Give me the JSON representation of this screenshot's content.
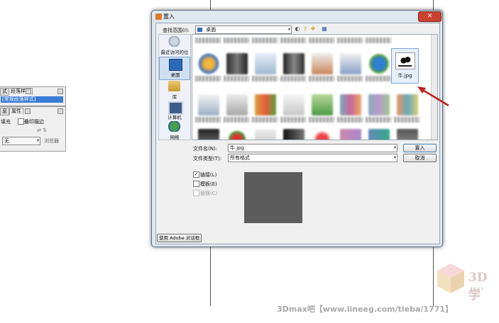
{
  "dialog": {
    "title": "置入",
    "close_glyph": "✕",
    "look_in_label": "查找范围(I):",
    "look_in_value": "桌面",
    "places": [
      {
        "label": "最近访问的位置",
        "icon": "recent-places-icon"
      },
      {
        "label": "桌面",
        "icon": "desktop-icon",
        "selected": true
      },
      {
        "label": "库",
        "icon": "library-icon"
      },
      {
        "label": "计算机",
        "icon": "computer-icon"
      },
      {
        "label": "网络",
        "icon": "network-icon"
      }
    ],
    "toolbar_icons": [
      "back-icon",
      "up-folder-icon",
      "new-folder-icon",
      "view-menu-icon"
    ],
    "selected_file": {
      "name": "牛.jpg"
    },
    "filename_label": "文件名(N):",
    "filename_value": "牛.jpg",
    "filetype_label": "文件类型(T):",
    "filetype_value": "所有格式",
    "open_button": "置入",
    "cancel_button": "取消",
    "options": [
      {
        "label": "链接(L)",
        "checked": true,
        "enabled": true
      },
      {
        "label": "模板(E)",
        "checked": false,
        "enabled": true
      },
      {
        "label": "替换(C)",
        "checked": false,
        "enabled": false
      }
    ],
    "adobe_dialog_button": "使用 Adobe 对话框"
  },
  "left_panel": {
    "tab_char_styles": "式",
    "tab_para_styles": "段落样式",
    "selected_style": "[常规段落样式]",
    "tab_a": "息",
    "tab_attributes": "属性",
    "fill_label": "填充",
    "overprint_label": "叠印描边",
    "none_value": "无",
    "browse_label": "浏览器"
  },
  "watermark": {
    "text": "3Dmax吧【www.lineeg.com/tieba/1771】",
    "logo": "3D学",
    "logo_sub": "3DXY"
  },
  "colors": {
    "title_bar": "#dfe7ef",
    "close_button": "#c9422e",
    "selection_blue": "#3a7bd5",
    "annotation_arrow": "#c0201c"
  }
}
